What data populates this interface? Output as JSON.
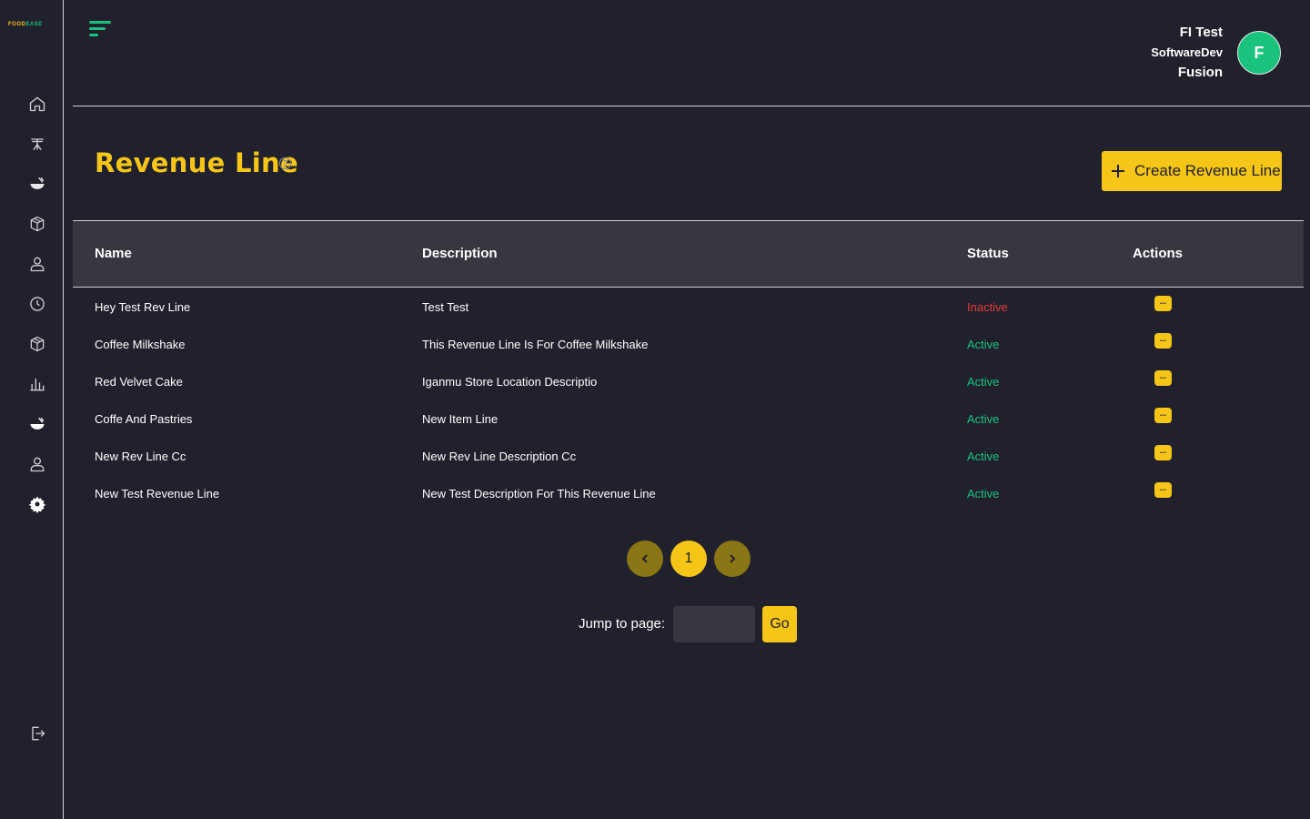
{
  "app": {
    "logo_part1": "FOOD",
    "logo_part2": "EASE"
  },
  "sidebar": {
    "items": [
      {
        "name": "home",
        "icon": "home-icon"
      },
      {
        "name": "dining",
        "icon": "dining-table-icon"
      },
      {
        "name": "food",
        "icon": "food-bowl-icon"
      },
      {
        "name": "inventory",
        "icon": "box-icon"
      },
      {
        "name": "users",
        "icon": "user-icon"
      },
      {
        "name": "history",
        "icon": "clock-icon"
      },
      {
        "name": "products",
        "icon": "box-icon"
      },
      {
        "name": "reports",
        "icon": "bar-chart-icon"
      },
      {
        "name": "menu",
        "icon": "food-bowl-icon"
      },
      {
        "name": "staff",
        "icon": "user-icon"
      },
      {
        "name": "settings",
        "icon": "gear-icon"
      },
      {
        "name": "logout",
        "icon": "logout-icon"
      }
    ]
  },
  "user": {
    "name": "FI Test",
    "org": "SoftwareDev",
    "branch": "Fusion",
    "avatar_initial": "F"
  },
  "page": {
    "title": "Revenue Line",
    "create_button": "Create Revenue Line"
  },
  "table": {
    "columns": [
      "Name",
      "Description",
      "Status",
      "Actions"
    ],
    "rows": [
      {
        "name": "Hey Test Rev Line",
        "description": "Test Test",
        "status": "Inactive"
      },
      {
        "name": "Coffee Milkshake",
        "description": "This Revenue Line Is For Coffee Milkshake",
        "status": "Active"
      },
      {
        "name": "Red Velvet Cake",
        "description": "Iganmu Store Location Descriptio",
        "status": "Active"
      },
      {
        "name": "Coffe And Pastries",
        "description": "New Item Line",
        "status": "Active"
      },
      {
        "name": "New Rev Line Cc",
        "description": "New Rev Line Description Cc",
        "status": "Active"
      },
      {
        "name": "New Test Revenue Line",
        "description": "New Test Description For This Revenue Line",
        "status": "Active"
      }
    ],
    "action_glyph": "..."
  },
  "pagination": {
    "current_page": "1",
    "jump_label": "Jump to page:",
    "jump_value": "",
    "go_label": "Go"
  },
  "colors": {
    "accent": "#f5c518",
    "success": "#19c37d",
    "danger": "#e5383b",
    "background": "#21212d",
    "header_row": "#373740"
  }
}
